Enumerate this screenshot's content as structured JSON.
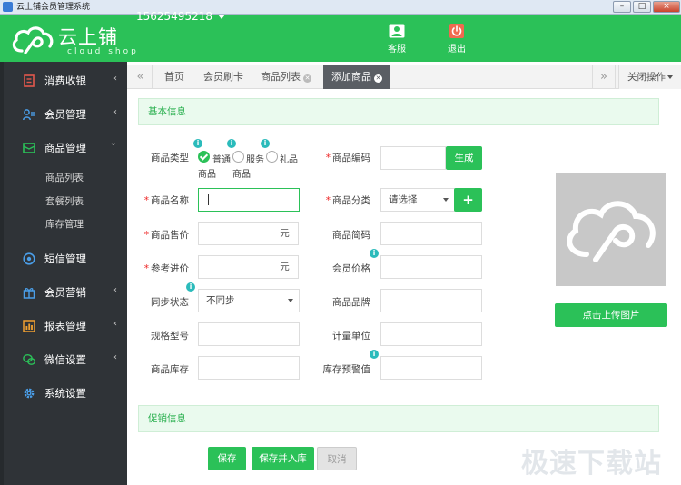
{
  "window": {
    "title": "云上铺会员管理系统",
    "buttons": [
      "–",
      "□",
      "×"
    ]
  },
  "header": {
    "logo_name": "云上铺",
    "logo_sub": "cloud shop",
    "phone": "15625495218",
    "service_label": "客服",
    "logout_label": "退出"
  },
  "sidebar": {
    "items": [
      {
        "label": "消费收银",
        "arrow": "‹"
      },
      {
        "label": "会员管理",
        "arrow": "‹"
      },
      {
        "label": "商品管理",
        "arrow": "⌄"
      },
      {
        "label": "短信管理",
        "arrow": ""
      },
      {
        "label": "会员营销",
        "arrow": "‹"
      },
      {
        "label": "报表管理",
        "arrow": "‹"
      },
      {
        "label": "微信设置",
        "arrow": "‹"
      },
      {
        "label": "系统设置",
        "arrow": ""
      }
    ],
    "subitems": [
      "商品列表",
      "套餐列表",
      "库存管理"
    ]
  },
  "tabs": {
    "prev": "«",
    "next": "»",
    "items": [
      "首页",
      "会员刷卡",
      "商品列表",
      "添加商品"
    ],
    "close_ops": "关闭操作"
  },
  "sections": {
    "basic": "基本信息",
    "promo": "促销信息"
  },
  "form": {
    "type_label": "商品类型",
    "type_options": [
      {
        "line1": "普通",
        "line2": "商品"
      },
      {
        "line1": "服务",
        "line2": "商品"
      },
      {
        "line1": "礼品",
        "line2": ""
      }
    ],
    "code_label": "商品编码",
    "generate": "生成",
    "name_label": "商品名称",
    "category_label": "商品分类",
    "category_value": "请选择",
    "add_category": "+",
    "price_label": "商品售价",
    "price_unit": "元",
    "short_label": "商品简码",
    "cost_label": "参考进价",
    "cost_unit": "元",
    "member_price_label": "会员价格",
    "sync_label": "同步状态",
    "sync_value": "不同步",
    "brand_label": "商品品牌",
    "spec_label": "规格型号",
    "unit_label": "计量单位",
    "stock_label": "商品库存",
    "alert_label": "库存预警值",
    "required_mark": "*",
    "info_glyph": "i"
  },
  "upload": {
    "label": "点击上传图片"
  },
  "actions": {
    "save": "保存",
    "save_stock": "保存并入库",
    "cancel": "取消"
  },
  "watermark": "极速下载站",
  "colors": {
    "brand": "#2bc158",
    "sidebar": "#2f3337",
    "tab_active": "#5a5e64"
  }
}
